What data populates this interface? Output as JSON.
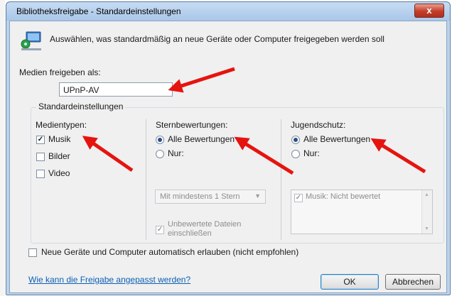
{
  "window": {
    "title": "Bibliotheksfreigabe - Standardeinstellungen",
    "close_label": "x"
  },
  "intro": {
    "text": "Auswählen, was standardmäßig an neue Geräte oder Computer freigegeben werden soll"
  },
  "share_as": {
    "label": "Medien freigeben als:",
    "value": "UPnP-AV"
  },
  "defaults": {
    "legend": "Standardeinstellungen",
    "media_types": {
      "heading": "Medientypen:",
      "items": [
        {
          "label": "Musik",
          "checked": true
        },
        {
          "label": "Bilder",
          "checked": false
        },
        {
          "label": "Video",
          "checked": false
        }
      ]
    },
    "star_ratings": {
      "heading": "Sternbewertungen:",
      "all_label": "Alle Bewertungen",
      "only_label": "Nur:",
      "min_select": "Mit mindestens 1 Stern",
      "unrated_label_1": "Unbewertete Dateien",
      "unrated_label_2": "einschließen"
    },
    "parental": {
      "heading": "Jugendschutz:",
      "all_label": "Alle Bewertungen",
      "only_label": "Nur:",
      "list_items": [
        "Musik: Nicht bewertet"
      ]
    }
  },
  "auto_allow": {
    "label": "Neue Geräte und Computer automatisch erlauben (nicht empfohlen)"
  },
  "footer": {
    "help_link": "Wie kann die Freigabe angepasst werden?",
    "ok_label": "OK",
    "cancel_label": "Abbrechen"
  },
  "colors": {
    "arrow": "#e5140f",
    "link": "#0b5fb5",
    "title_bar": "#b9d1ea"
  }
}
